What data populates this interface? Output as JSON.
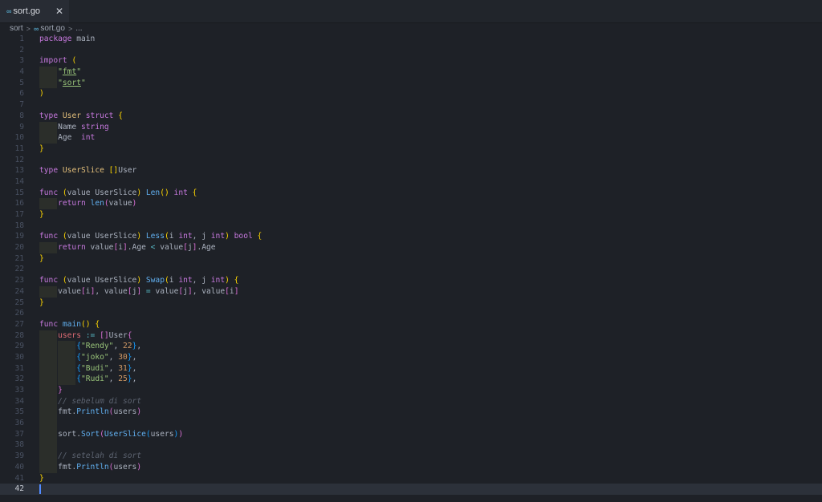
{
  "tab": {
    "icon": "∞",
    "title": "sort.go",
    "close": "✕"
  },
  "breadcrumb": {
    "folder": "sort",
    "file": "sort.go",
    "more": "..."
  },
  "lines": [
    [
      {
        "t": "package ",
        "c": "kw"
      },
      {
        "t": "main",
        "c": ""
      }
    ],
    [],
    [
      {
        "t": "import ",
        "c": "kw"
      },
      {
        "t": "(",
        "c": "br1"
      }
    ],
    [
      {
        "t": "\"",
        "c": "str"
      },
      {
        "t": "fmt",
        "c": "str uline"
      },
      {
        "t": "\"",
        "c": "str"
      }
    ],
    [
      {
        "t": "\"",
        "c": "str"
      },
      {
        "t": "sort",
        "c": "str uline"
      },
      {
        "t": "\"",
        "c": "str"
      }
    ],
    [
      {
        "t": ")",
        "c": "br1"
      }
    ],
    [],
    [
      {
        "t": "type ",
        "c": "kw"
      },
      {
        "t": "User ",
        "c": "ty"
      },
      {
        "t": "struct ",
        "c": "kw"
      },
      {
        "t": "{",
        "c": "br1"
      }
    ],
    [
      {
        "t": "Name ",
        "c": ""
      },
      {
        "t": "string",
        "c": "kw"
      }
    ],
    [
      {
        "t": "Age  ",
        "c": ""
      },
      {
        "t": "int",
        "c": "kw"
      }
    ],
    [
      {
        "t": "}",
        "c": "br1"
      }
    ],
    [],
    [
      {
        "t": "type ",
        "c": "kw"
      },
      {
        "t": "UserSlice ",
        "c": "ty"
      },
      {
        "t": "[]",
        "c": "br1"
      },
      {
        "t": "User",
        "c": ""
      }
    ],
    [],
    [
      {
        "t": "func ",
        "c": "kw"
      },
      {
        "t": "(",
        "c": "br1"
      },
      {
        "t": "value UserSlice",
        "c": ""
      },
      {
        "t": ")",
        "c": "br1"
      },
      {
        "t": " ",
        "c": ""
      },
      {
        "t": "Len",
        "c": "fn"
      },
      {
        "t": "()",
        "c": "br1"
      },
      {
        "t": " ",
        "c": ""
      },
      {
        "t": "int",
        "c": "kw"
      },
      {
        "t": " ",
        "c": ""
      },
      {
        "t": "{",
        "c": "br1"
      }
    ],
    [
      {
        "t": "return ",
        "c": "kw"
      },
      {
        "t": "len",
        "c": "fn"
      },
      {
        "t": "(",
        "c": "br2"
      },
      {
        "t": "value",
        "c": ""
      },
      {
        "t": ")",
        "c": "br2"
      }
    ],
    [
      {
        "t": "}",
        "c": "br1"
      }
    ],
    [],
    [
      {
        "t": "func ",
        "c": "kw"
      },
      {
        "t": "(",
        "c": "br1"
      },
      {
        "t": "value UserSlice",
        "c": ""
      },
      {
        "t": ")",
        "c": "br1"
      },
      {
        "t": " ",
        "c": ""
      },
      {
        "t": "Less",
        "c": "fn"
      },
      {
        "t": "(",
        "c": "br1"
      },
      {
        "t": "i ",
        "c": ""
      },
      {
        "t": "int",
        "c": "kw"
      },
      {
        "t": ", j ",
        "c": ""
      },
      {
        "t": "int",
        "c": "kw"
      },
      {
        "t": ")",
        "c": "br1"
      },
      {
        "t": " ",
        "c": ""
      },
      {
        "t": "bool",
        "c": "kw"
      },
      {
        "t": " ",
        "c": ""
      },
      {
        "t": "{",
        "c": "br1"
      }
    ],
    [
      {
        "t": "return ",
        "c": "kw"
      },
      {
        "t": "value",
        "c": ""
      },
      {
        "t": "[",
        "c": "br2"
      },
      {
        "t": "i",
        "c": ""
      },
      {
        "t": "]",
        "c": "br2"
      },
      {
        "t": ".Age ",
        "c": ""
      },
      {
        "t": "<",
        "c": "op"
      },
      {
        "t": " value",
        "c": ""
      },
      {
        "t": "[",
        "c": "br2"
      },
      {
        "t": "j",
        "c": ""
      },
      {
        "t": "]",
        "c": "br2"
      },
      {
        "t": ".Age",
        "c": ""
      }
    ],
    [
      {
        "t": "}",
        "c": "br1"
      }
    ],
    [],
    [
      {
        "t": "func ",
        "c": "kw"
      },
      {
        "t": "(",
        "c": "br1"
      },
      {
        "t": "value UserSlice",
        "c": ""
      },
      {
        "t": ")",
        "c": "br1"
      },
      {
        "t": " ",
        "c": ""
      },
      {
        "t": "Swap",
        "c": "fn"
      },
      {
        "t": "(",
        "c": "br1"
      },
      {
        "t": "i ",
        "c": ""
      },
      {
        "t": "int",
        "c": "kw"
      },
      {
        "t": ", j ",
        "c": ""
      },
      {
        "t": "int",
        "c": "kw"
      },
      {
        "t": ")",
        "c": "br1"
      },
      {
        "t": " ",
        "c": ""
      },
      {
        "t": "{",
        "c": "br1"
      }
    ],
    [
      {
        "t": "value",
        "c": ""
      },
      {
        "t": "[",
        "c": "br2"
      },
      {
        "t": "i",
        "c": ""
      },
      {
        "t": "]",
        "c": "br2"
      },
      {
        "t": ", value",
        "c": ""
      },
      {
        "t": "[",
        "c": "br2"
      },
      {
        "t": "j",
        "c": ""
      },
      {
        "t": "]",
        "c": "br2"
      },
      {
        "t": " ",
        "c": ""
      },
      {
        "t": "=",
        "c": "op"
      },
      {
        "t": " value",
        "c": ""
      },
      {
        "t": "[",
        "c": "br2"
      },
      {
        "t": "j",
        "c": ""
      },
      {
        "t": "]",
        "c": "br2"
      },
      {
        "t": ", value",
        "c": ""
      },
      {
        "t": "[",
        "c": "br2"
      },
      {
        "t": "i",
        "c": ""
      },
      {
        "t": "]",
        "c": "br2"
      }
    ],
    [
      {
        "t": "}",
        "c": "br1"
      }
    ],
    [],
    [
      {
        "t": "func ",
        "c": "kw"
      },
      {
        "t": "main",
        "c": "fn"
      },
      {
        "t": "()",
        "c": "br1"
      },
      {
        "t": " ",
        "c": ""
      },
      {
        "t": "{",
        "c": "br1"
      }
    ],
    [
      {
        "t": "users ",
        "c": "var"
      },
      {
        "t": ":=",
        "c": "op"
      },
      {
        "t": " ",
        "c": ""
      },
      {
        "t": "[]",
        "c": "br2"
      },
      {
        "t": "User",
        "c": ""
      },
      {
        "t": "{",
        "c": "br2"
      }
    ],
    [
      {
        "t": "{",
        "c": "br3"
      },
      {
        "t": "\"Rendy\"",
        "c": "str"
      },
      {
        "t": ", ",
        "c": ""
      },
      {
        "t": "22",
        "c": "num"
      },
      {
        "t": "}",
        "c": "br3"
      },
      {
        "t": ",",
        "c": ""
      }
    ],
    [
      {
        "t": "{",
        "c": "br3"
      },
      {
        "t": "\"joko\"",
        "c": "str"
      },
      {
        "t": ", ",
        "c": ""
      },
      {
        "t": "30",
        "c": "num"
      },
      {
        "t": "}",
        "c": "br3"
      },
      {
        "t": ",",
        "c": ""
      }
    ],
    [
      {
        "t": "{",
        "c": "br3"
      },
      {
        "t": "\"Budi\"",
        "c": "str"
      },
      {
        "t": ", ",
        "c": ""
      },
      {
        "t": "31",
        "c": "num"
      },
      {
        "t": "}",
        "c": "br3"
      },
      {
        "t": ",",
        "c": ""
      }
    ],
    [
      {
        "t": "{",
        "c": "br3"
      },
      {
        "t": "\"Rudi\"",
        "c": "str"
      },
      {
        "t": ", ",
        "c": ""
      },
      {
        "t": "25",
        "c": "num"
      },
      {
        "t": "}",
        "c": "br3"
      },
      {
        "t": ",",
        "c": ""
      }
    ],
    [
      {
        "t": "}",
        "c": "br2"
      }
    ],
    [
      {
        "t": "// sebelum di sort",
        "c": "cmt"
      }
    ],
    [
      {
        "t": "fmt",
        "c": ""
      },
      {
        "t": ".",
        "c": ""
      },
      {
        "t": "Println",
        "c": "fn"
      },
      {
        "t": "(",
        "c": "br2"
      },
      {
        "t": "users",
        "c": ""
      },
      {
        "t": ")",
        "c": "br2"
      }
    ],
    [],
    [
      {
        "t": "sort",
        "c": ""
      },
      {
        "t": ".",
        "c": ""
      },
      {
        "t": "Sort",
        "c": "fn"
      },
      {
        "t": "(",
        "c": "br2"
      },
      {
        "t": "UserSlice",
        "c": "fn"
      },
      {
        "t": "(",
        "c": "br3"
      },
      {
        "t": "users",
        "c": ""
      },
      {
        "t": ")",
        "c": "br3"
      },
      {
        "t": ")",
        "c": "br2"
      }
    ],
    [],
    [
      {
        "t": "// setelah di sort",
        "c": "cmt"
      }
    ],
    [
      {
        "t": "fmt",
        "c": ""
      },
      {
        "t": ".",
        "c": ""
      },
      {
        "t": "Println",
        "c": "fn"
      },
      {
        "t": "(",
        "c": "br2"
      },
      {
        "t": "users",
        "c": ""
      },
      {
        "t": ")",
        "c": "br2"
      }
    ],
    [
      {
        "t": "}",
        "c": "br1"
      }
    ],
    []
  ],
  "current_line": 42
}
